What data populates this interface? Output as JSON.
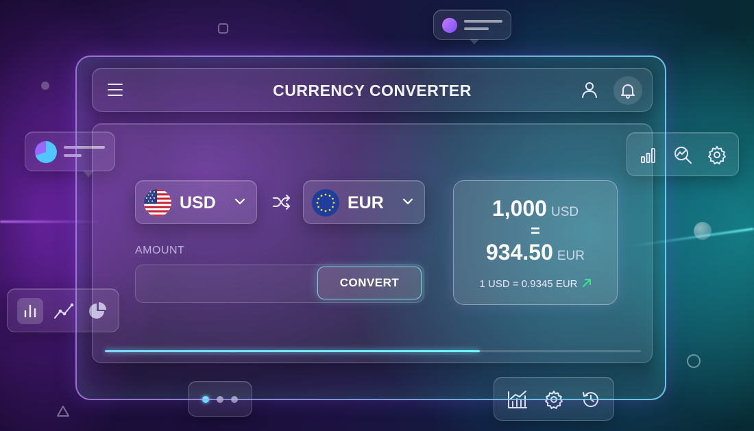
{
  "app": {
    "title": "CURRENCY CONVERTER"
  },
  "header": {
    "menu_icon": "hamburger-menu-icon",
    "user_icon": "user-icon",
    "notification_icon": "bell-icon"
  },
  "converter": {
    "from": {
      "code": "USD",
      "flag": "us-flag-icon"
    },
    "to": {
      "code": "EUR",
      "flag": "eu-flag-icon"
    },
    "swap_icon": "shuffle-swap-icon",
    "amount_label": "AMOUNT",
    "amount_value": "",
    "convert_label": "CONVERT"
  },
  "result": {
    "from_amount": "1,000",
    "from_unit": "USD",
    "equals": "=",
    "to_amount": "934.50",
    "to_unit": "EUR",
    "rate_text": "1 USD = 0.9345 EUR",
    "trend_icon": "trend-up-arrow-icon",
    "trend_color": "#3ee28e"
  },
  "progress": {
    "fraction": 0.7
  },
  "widgets": {
    "right_toolbar": [
      "bar-chart-icon",
      "analytics-search-icon",
      "gear-icon"
    ],
    "left_toolbar": [
      "bar-chart-icon",
      "line-chart-icon",
      "pie-chart-icon"
    ],
    "bottom_toolbar": [
      "growth-chart-icon",
      "gear-icon",
      "history-icon"
    ],
    "pager_dots": 3,
    "pager_active_index": 0
  },
  "colors": {
    "accent_cyan": "#6ff5ff",
    "accent_purple": "#9a66ff",
    "active_dot": "#6ee6ff"
  }
}
